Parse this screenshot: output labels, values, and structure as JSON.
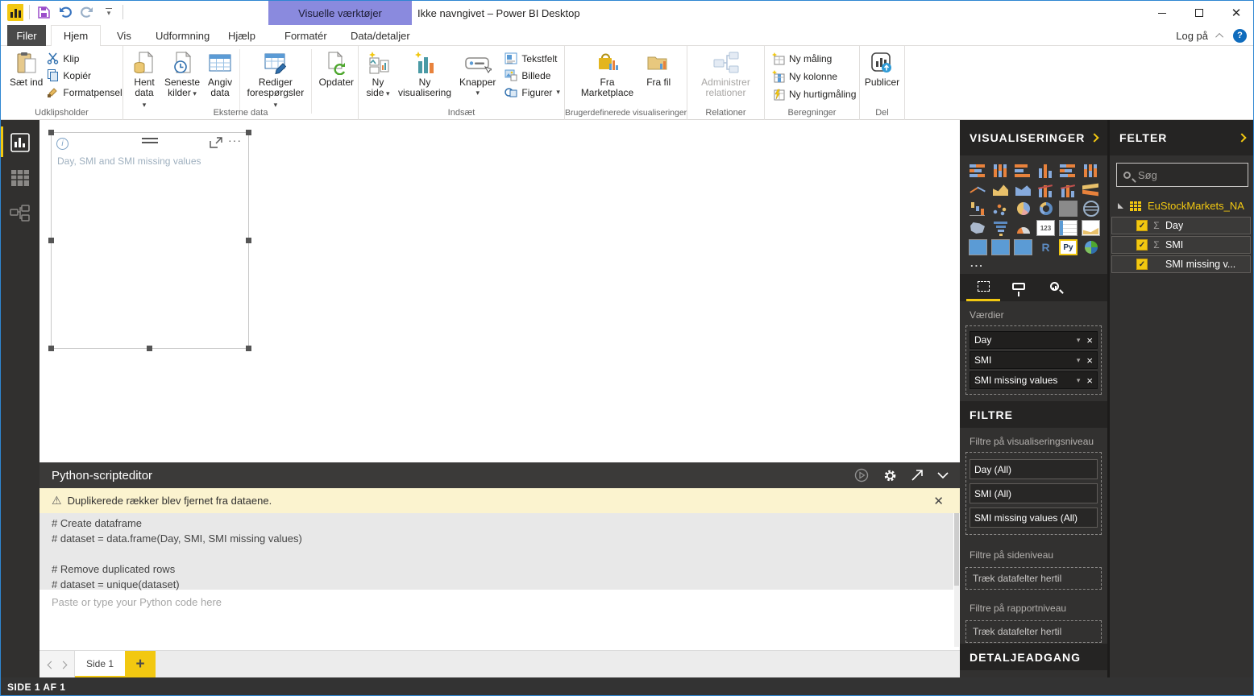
{
  "window": {
    "title": "Ikke navngivet – Power BI Desktop",
    "contextual_group_label": "Visuelle værktøjer",
    "login_label": "Log på",
    "help_glyph": "?"
  },
  "tabs": {
    "file": "Filer",
    "home": "Hjem",
    "view": "Vis",
    "modeling": "Udformning",
    "help": "Hjælp",
    "format": "Formatér",
    "data_detail": "Data/detaljer"
  },
  "ribbon": {
    "clipboard": {
      "paste": "Sæt ind",
      "cut": "Klip",
      "copy": "Kopiér",
      "format_painter": "Formatpensel",
      "group": "Udklipsholder"
    },
    "external_data": {
      "get_data": "Hent\ndata",
      "recent_sources": "Seneste\nkilder",
      "enter_data": "Angiv\ndata",
      "edit_queries": "Rediger\nforespørgsler",
      "refresh": "Opdater",
      "group": "Eksterne data"
    },
    "insert": {
      "new_page": "Ny\nside",
      "new_visual": "Ny\nvisualisering",
      "buttons": "Knapper",
      "text_box": "Tekstfelt",
      "image": "Billede",
      "shapes": "Figurer",
      "group": "Indsæt"
    },
    "custom_visuals": {
      "from_marketplace": "Fra\nMarketplace",
      "from_file": "Fra fil",
      "group": "Brugerdefinerede visualiseringer"
    },
    "relationships": {
      "manage": "Administrer\nrelationer",
      "group": "Relationer"
    },
    "calculations": {
      "new_measure": "Ny måling",
      "new_column": "Ny kolonne",
      "new_quick_measure": "Ny hurtigmåling",
      "group": "Beregninger"
    },
    "share": {
      "publish": "Publicer",
      "group": "Del"
    }
  },
  "canvas": {
    "visual_title": "Day, SMI and SMI missing values"
  },
  "script_editor": {
    "title": "Python-scripteditor",
    "warning": "Duplikerede rækker blev fjernet fra dataene.",
    "warning_glyph": "⚠",
    "code_lines": [
      "# Create dataframe",
      "# dataset = data.frame(Day, SMI, SMI missing values)",
      "",
      "# Remove duplicated rows",
      "# dataset = unique(dataset)"
    ],
    "placeholder": "Paste or type your Python code here"
  },
  "visualizations_panel": {
    "title": "VISUALISERINGER",
    "more_label": "...",
    "values_label": "Værdier",
    "wells": [
      "Day",
      "SMI",
      "SMI missing values"
    ],
    "icons": [
      {
        "name": "stacked-bar-chart-icon",
        "cls": "vz-stack-h"
      },
      {
        "name": "stacked-column-chart-icon",
        "cls": "vz-stack-v"
      },
      {
        "name": "clustered-bar-chart-icon",
        "cls": "vz-bar-h"
      },
      {
        "name": "clustered-column-chart-icon",
        "cls": "vz-bar-v"
      },
      {
        "name": "100-stacked-bar-chart-icon",
        "cls": "vz-stack-h"
      },
      {
        "name": "100-stacked-column-chart-icon",
        "cls": "vz-stack-v"
      },
      {
        "name": "line-chart-icon",
        "cls": "vz-line"
      },
      {
        "name": "area-chart-icon",
        "cls": "vz-area"
      },
      {
        "name": "stacked-area-chart-icon",
        "cls": "vz-area2"
      },
      {
        "name": "line-clustered-column-chart-icon",
        "cls": "vz-combo"
      },
      {
        "name": "line-stacked-column-chart-icon",
        "cls": "vz-combo"
      },
      {
        "name": "ribbon-chart-icon",
        "cls": "vz-ribbon"
      },
      {
        "name": "waterfall-chart-icon",
        "cls": "vz-waterfall"
      },
      {
        "name": "scatter-chart-icon",
        "cls": "vz-dots"
      },
      {
        "name": "pie-chart-icon",
        "cls": "vz-pie"
      },
      {
        "name": "donut-chart-icon",
        "cls": "vz-donut"
      },
      {
        "name": "treemap-icon",
        "cls": "vz-treemap"
      },
      {
        "name": "map-icon",
        "cls": "vz-globe"
      },
      {
        "name": "filled-map-icon",
        "cls": "vz-fmap"
      },
      {
        "name": "funnel-chart-icon",
        "cls": "vz-funnel"
      },
      {
        "name": "gauge-icon",
        "cls": "vz-gauge"
      },
      {
        "name": "card-icon",
        "cls": "vz-card",
        "glyph": "123"
      },
      {
        "name": "multi-row-card-icon",
        "cls": "vz-mcard"
      },
      {
        "name": "kpi-icon",
        "cls": "vz-kpi"
      },
      {
        "name": "slicer-icon",
        "cls": "vz-slicer"
      },
      {
        "name": "table-icon",
        "cls": "vz-table"
      },
      {
        "name": "matrix-icon",
        "cls": "vz-matrix"
      },
      {
        "name": "r-script-icon",
        "cls": "vz-r",
        "glyph": "R"
      },
      {
        "name": "python-script-icon",
        "cls": "vz-py",
        "glyph": "Py"
      },
      {
        "name": "arcgis-map-icon",
        "cls": "vz-globe2"
      }
    ]
  },
  "filters_panel": {
    "title": "FILTRE",
    "visual_level_label": "Filtre på visualiseringsniveau",
    "visual_filters": [
      "Day  (All)",
      "SMI  (All)",
      "SMI missing values  (All)"
    ],
    "page_level_label": "Filtre på sideniveau",
    "page_drop_hint": "Træk datafelter hertil",
    "report_level_label": "Filtre på rapportniveau",
    "report_drop_hint": "Træk datafelter hertil",
    "drillthrough_label": "DETALJEADGANG"
  },
  "fields_panel": {
    "title": "FELTER",
    "search_placeholder": "Søg",
    "table_name": "EuStockMarkets_NA",
    "check_glyph": "✓",
    "fields": [
      {
        "label": "Day",
        "sigma": "Σ"
      },
      {
        "label": "SMI",
        "sigma": "Σ"
      },
      {
        "label": "SMI missing v...",
        "sigma": ""
      }
    ]
  },
  "pages": {
    "tab_label": "Side 1"
  },
  "status_bar": {
    "text": "SIDE 1 AF 1"
  },
  "colors": {
    "accent": "#f2c811",
    "panel_bg": "#323130",
    "header_bg": "#252423",
    "warning_bg": "#fbf3cf",
    "contextual_tab": "#8a8ade"
  }
}
